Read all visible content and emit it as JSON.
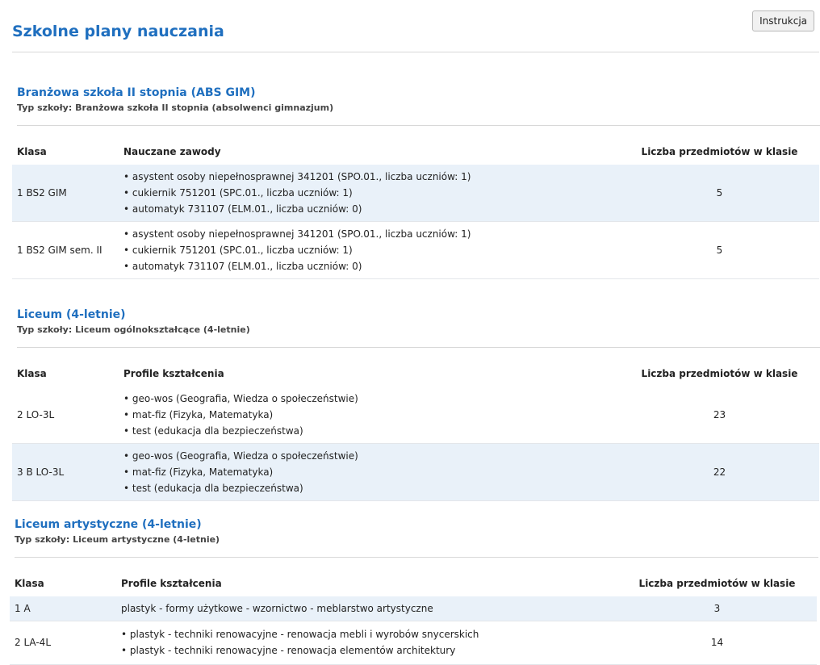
{
  "header": {
    "title": "Szkolne plany nauczania",
    "instruction_button": "Instrukcja"
  },
  "sections": [
    {
      "title": "Branżowa szkoła II stopnia (ABS GIM)",
      "subtitle": "Typ szkoły: Branżowa szkoła II stopnia (absolwenci gimnazjum)",
      "columns": [
        "Klasa",
        "Nauczane zawody",
        "Liczba przedmiotów w klasie"
      ],
      "rows": [
        {
          "klasa": "1 BS2 GIM",
          "items": [
            "asystent osoby niepełnosprawnej 341201 (SPO.01., liczba uczniów: 1)",
            "cukiernik 751201 (SPC.01., liczba uczniów: 1)",
            "automatyk 731107 (ELM.01., liczba uczniów: 0)"
          ],
          "count": "5"
        },
        {
          "klasa": "1 BS2 GIM sem. II",
          "items": [
            "asystent osoby niepełnosprawnej 341201 (SPO.01., liczba uczniów: 1)",
            "cukiernik 751201 (SPC.01., liczba uczniów: 1)",
            "automatyk 731107 (ELM.01., liczba uczniów: 0)"
          ],
          "count": "5"
        }
      ]
    },
    {
      "title": "Liceum (4-letnie)",
      "subtitle": "Typ szkoły: Liceum ogólnokształcące (4-letnie)",
      "columns": [
        "Klasa",
        "Profile kształcenia",
        "Liczba przedmiotów w klasie"
      ],
      "rows": [
        {
          "klasa": "2 LO-3L",
          "items": [
            "geo-wos (Geografia, Wiedza o społeczeństwie)",
            "mat-fiz (Fizyka, Matematyka)",
            "test (edukacja dla bezpieczeństwa)"
          ],
          "count": "23"
        },
        {
          "klasa": "3 B LO-3L",
          "items": [
            "geo-wos (Geografia, Wiedza o społeczeństwie)",
            "mat-fiz (Fizyka, Matematyka)",
            "test (edukacja dla bezpieczeństwa)"
          ],
          "count": "22"
        }
      ]
    },
    {
      "title": "Liceum artystyczne (4-letnie)",
      "subtitle": "Typ szkoły: Liceum artystyczne (4-letnie)",
      "columns": [
        "Klasa",
        "Profile kształcenia",
        "Liczba przedmiotów w klasie"
      ],
      "rows": [
        {
          "klasa": "1 A",
          "text": "plastyk - formy użytkowe - wzornictwo - meblarstwo artystyczne",
          "count": "3"
        },
        {
          "klasa": "2 LA-4L",
          "items": [
            "plastyk - techniki renowacyjne - renowacja mebli i wyrobów snycerskich",
            "plastyk - techniki renowacyjne - renowacja elementów architektury"
          ],
          "count": "14"
        }
      ]
    }
  ]
}
